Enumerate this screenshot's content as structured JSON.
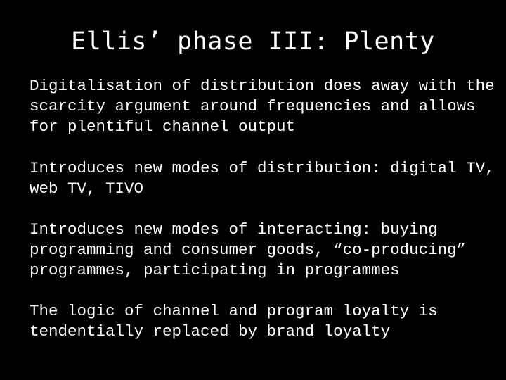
{
  "slide": {
    "background_color": "#000000",
    "text_color": "#ffffff",
    "title": "Ellis’ phase III: Plenty",
    "paragraphs": [
      {
        "id": "paragraph-digitalisation",
        "text": "Digitalisation of distribution does away with the scarcity argument around frequencies and allows for plentiful channel output",
        "lines": [
          "Digitalisation of distribution does away with",
          "the scarcity argument around frequencies and",
          "allows for plentiful channel output"
        ]
      },
      {
        "id": "paragraph-modes-distribution",
        "text": "Introduces new modes of distribution: digital TV, web TV, TIVO",
        "lines": [
          "Introduces new modes of distribution: digital",
          "TV, web TV, TIVO"
        ]
      },
      {
        "id": "paragraph-modes-interacting",
        "text": "Introduces new modes of interacting: buying programming and consumer goods, “co-producing” programmes, participating in programmes",
        "lines": [
          "Introduces new modes of interacting: buying",
          "programming and consumer goods, “co-",
          "producing” programmes, participating in",
          "programmes"
        ]
      },
      {
        "id": "paragraph-loyalty",
        "text": "The logic of channel and program loyalty is tendentially replaced by brand loyalty",
        "lines": [
          "The logic of channel and program loyalty is",
          "tendentially replaced by brand loyalty"
        ]
      }
    ]
  }
}
